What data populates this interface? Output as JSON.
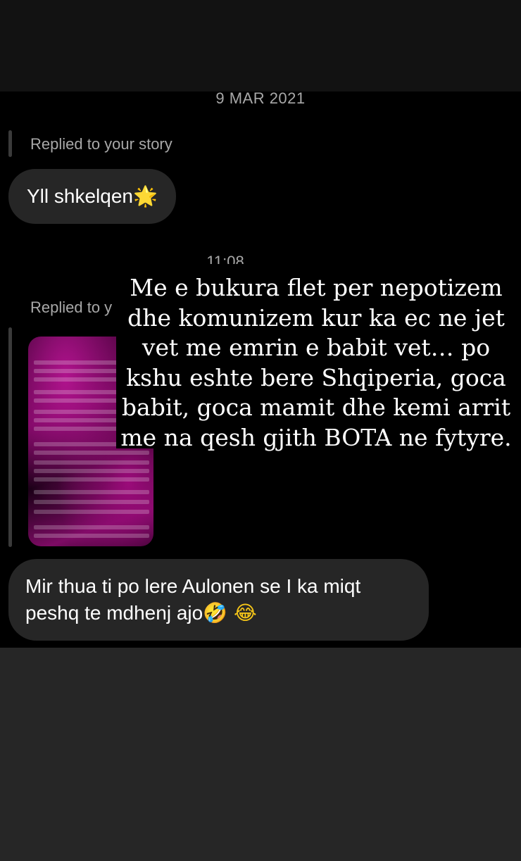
{
  "date_divider": "9 MAR 2021",
  "reply1": {
    "label": "Replied to your story",
    "message": "Yll shkelqen",
    "emoji": "🌟"
  },
  "time_divider": "11:08",
  "reply2": {
    "label": "Replied to y"
  },
  "story_overlay_text": "Me e bukura flet per nepotizem dhe komunizem kur ka ec ne jet vet me emrin e babit vet… po kshu eshte bere Shqiperia, goca babit, goca mamit dhe kemi arrit me na qesh gjith BOTA ne fytyre.",
  "message2": {
    "line1": "Mir thua ti po lere Aulonen se I ka miqt",
    "line2": "peshq te mdhenj ajo",
    "emojis": "🤣 😂"
  },
  "colors": {
    "chat_background": "#000000",
    "bubble": "#262626",
    "meta_text": "#a8a8a8",
    "story_accent": "#b0138d"
  }
}
